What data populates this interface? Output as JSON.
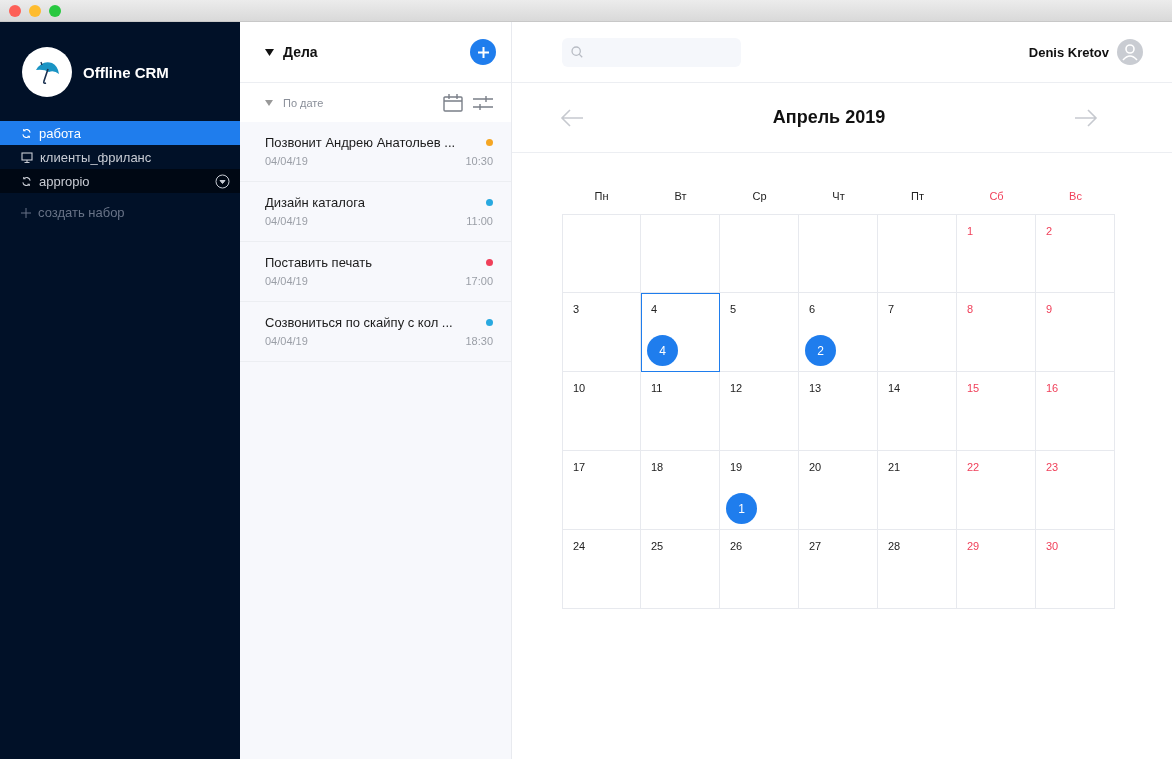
{
  "sidebar": {
    "app_name": "Offline CRM",
    "sets": [
      {
        "label": "работа",
        "kind": "sync",
        "selected": true,
        "hovered": false,
        "menu": false
      },
      {
        "label": "клиенты_фриланс",
        "kind": "monitor",
        "selected": false,
        "hovered": false,
        "menu": false
      },
      {
        "label": "appropio",
        "kind": "sync",
        "selected": false,
        "hovered": true,
        "menu": true
      }
    ],
    "create_set": "создать набор"
  },
  "tasks": {
    "title": "Дела",
    "sort": "По дате",
    "items": [
      {
        "title": "Позвонит Андрею Анатольев ...",
        "date": "04/04/19",
        "time": "10:30",
        "color": "#f5a623"
      },
      {
        "title": "Дизайн каталога",
        "date": "04/04/19",
        "time": "11:00",
        "color": "#29a9e0"
      },
      {
        "title": "Поставить печать",
        "date": "04/04/19",
        "time": "17:00",
        "color": "#f0405a"
      },
      {
        "title": "Созвониться по скайпу с кол ...",
        "date": "04/04/19",
        "time": "18:30",
        "color": "#29a9e0"
      }
    ]
  },
  "topbar": {
    "user": "Denis Kretov"
  },
  "calendar": {
    "month": "Апрель 2019",
    "weekdays": [
      {
        "label": "Пн",
        "weekend": false
      },
      {
        "label": "Вт",
        "weekend": false
      },
      {
        "label": "Ср",
        "weekend": false
      },
      {
        "label": "Чт",
        "weekend": false
      },
      {
        "label": "Пт",
        "weekend": false
      },
      {
        "label": "Сб",
        "weekend": true
      },
      {
        "label": "Вс",
        "weekend": true
      }
    ],
    "weeks": [
      [
        {
          "day": "1",
          "weekend": true,
          "selected": false
        },
        {
          "day": "2",
          "weekend": true,
          "selected": false
        }
      ],
      [
        {
          "day": "3",
          "weekend": false,
          "selected": false
        },
        {
          "day": "4",
          "weekend": false,
          "selected": true,
          "events": "4"
        },
        {
          "day": "5",
          "weekend": false,
          "selected": false
        },
        {
          "day": "6",
          "weekend": false,
          "selected": false,
          "events": "2"
        },
        {
          "day": "7",
          "weekend": false,
          "selected": false
        },
        {
          "day": "8",
          "weekend": true,
          "selected": false
        },
        {
          "day": "9",
          "weekend": true,
          "selected": false
        }
      ],
      [
        {
          "day": "10",
          "weekend": false,
          "selected": false
        },
        {
          "day": "11",
          "weekend": false,
          "selected": false
        },
        {
          "day": "12",
          "weekend": false,
          "selected": false
        },
        {
          "day": "13",
          "weekend": false,
          "selected": false
        },
        {
          "day": "14",
          "weekend": false,
          "selected": false
        },
        {
          "day": "15",
          "weekend": true,
          "selected": false
        },
        {
          "day": "16",
          "weekend": true,
          "selected": false
        }
      ],
      [
        {
          "day": "17",
          "weekend": false,
          "selected": false
        },
        {
          "day": "18",
          "weekend": false,
          "selected": false
        },
        {
          "day": "19",
          "weekend": false,
          "selected": false,
          "events": "1"
        },
        {
          "day": "20",
          "weekend": false,
          "selected": false
        },
        {
          "day": "21",
          "weekend": false,
          "selected": false
        },
        {
          "day": "22",
          "weekend": true,
          "selected": false
        },
        {
          "day": "23",
          "weekend": true,
          "selected": false
        }
      ],
      [
        {
          "day": "24",
          "weekend": false,
          "selected": false
        },
        {
          "day": "25",
          "weekend": false,
          "selected": false
        },
        {
          "day": "26",
          "weekend": false,
          "selected": false
        },
        {
          "day": "27",
          "weekend": false,
          "selected": false
        },
        {
          "day": "28",
          "weekend": false,
          "selected": false
        },
        {
          "day": "29",
          "weekend": true,
          "selected": false
        },
        {
          "day": "30",
          "weekend": true,
          "selected": false
        }
      ]
    ]
  }
}
